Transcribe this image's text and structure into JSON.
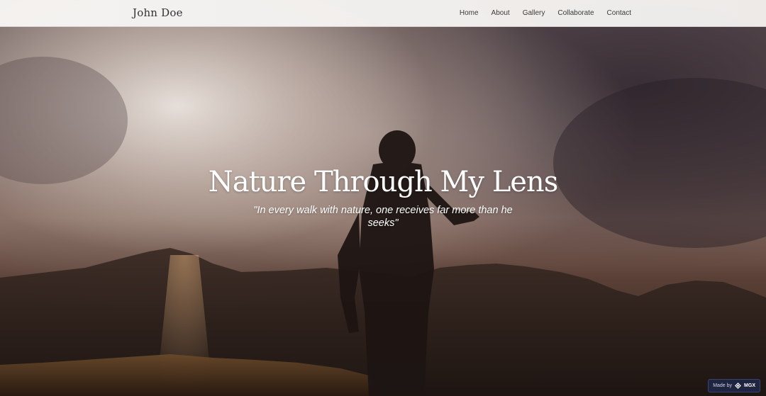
{
  "site": {
    "brand": "John Doe"
  },
  "nav": {
    "items": [
      {
        "label": "Home"
      },
      {
        "label": "About"
      },
      {
        "label": "Gallery"
      },
      {
        "label": "Collaborate"
      },
      {
        "label": "Contact"
      }
    ]
  },
  "hero": {
    "title": "Nature Through My Lens",
    "quote": "\"In every walk with nature, one receives far more than he seeks\""
  },
  "badge": {
    "prefix": "Made by",
    "brand": "MGX",
    "icon": "mgx-logo-icon"
  },
  "colors": {
    "nav_background": "#f4f2f0",
    "hero_text": "#ffffff",
    "badge_background": "#1f2440"
  }
}
